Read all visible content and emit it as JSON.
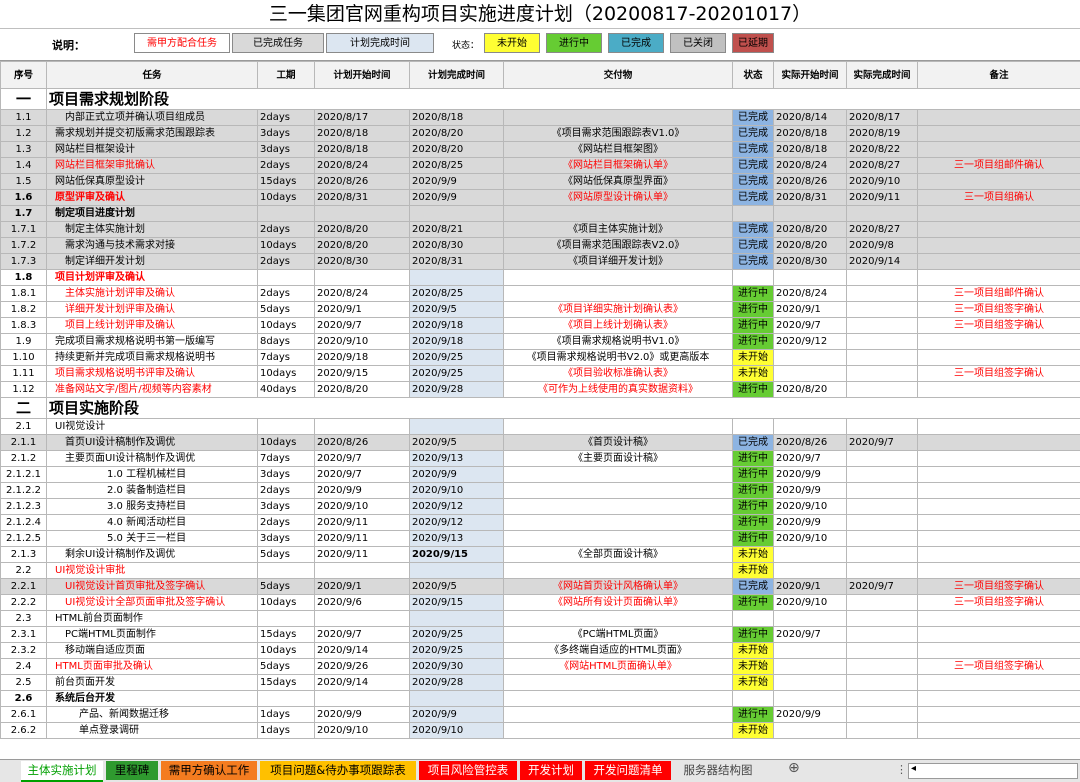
{
  "title": "三一集团官网重构项目实施进度计划（20200817-20201017）",
  "legend": {
    "label": "说明：",
    "items": [
      {
        "text": "需甲方配合任务",
        "bg": "#ffffff",
        "color": "#ff0000"
      },
      {
        "text": "已完成任务",
        "bg": "#d9d9d9",
        "color": "#000000"
      },
      {
        "text": "计划完成时间",
        "bg": "#dce6f1",
        "color": "#000000"
      }
    ],
    "status_label": "状态：",
    "statuses": [
      {
        "text": "未开始",
        "bg": "#ffff33"
      },
      {
        "text": "进行中",
        "bg": "#66cc33"
      },
      {
        "text": "已完成",
        "bg": "#4bacc6"
      },
      {
        "text": "已关闭",
        "bg": "#c0c0c0"
      },
      {
        "text": "已延期",
        "bg": "#c0504d"
      }
    ]
  },
  "columns": [
    "序号",
    "任务",
    "工期",
    "计划开始时间",
    "计划完成时间",
    "交付物",
    "状态",
    "实际开始时间",
    "实际完成时间",
    "备注"
  ],
  "rows": [
    {
      "type": "phase",
      "num": "一",
      "task": "项目需求规划阶段"
    },
    {
      "num": "1.1",
      "task": "内部正式立项并确认项目组成员",
      "dur": "2days",
      "ps": "2020/8/17",
      "pe": "2020/8/18",
      "deliv": "",
      "status": "已完成",
      "as": "2020/8/14",
      "ae": "2020/8/17",
      "note": "",
      "gray": true,
      "indent": 1
    },
    {
      "num": "1.2",
      "task": "需求规划并提交初版需求范围跟踪表",
      "dur": "3days",
      "ps": "2020/8/18",
      "pe": "2020/8/20",
      "deliv": "《项目需求范围跟踪表V1.0》",
      "status": "已完成",
      "as": "2020/8/18",
      "ae": "2020/8/19",
      "note": "",
      "gray": true,
      "indent": 0
    },
    {
      "num": "1.3",
      "task": "网站栏目框架设计",
      "dur": "3days",
      "ps": "2020/8/18",
      "pe": "2020/8/20",
      "deliv": "《网站栏目框架图》",
      "status": "已完成",
      "as": "2020/8/18",
      "ae": "2020/8/22",
      "note": "",
      "gray": true,
      "indent": 0
    },
    {
      "num": "1.4",
      "task": "网站栏目框架审批确认",
      "dur": "2days",
      "ps": "2020/8/24",
      "pe": "2020/8/25",
      "deliv": "《网站栏目框架确认单》",
      "status": "已完成",
      "as": "2020/8/24",
      "ae": "2020/8/27",
      "note": "三一项目组邮件确认",
      "gray": true,
      "red": true,
      "indent": 0
    },
    {
      "num": "1.5",
      "task": "网站低保真原型设计",
      "dur": "15days",
      "ps": "2020/8/26",
      "pe": "2020/9/9",
      "deliv": "《网站低保真原型界面》",
      "status": "已完成",
      "as": "2020/8/26",
      "ae": "2020/9/10",
      "note": "",
      "gray": true,
      "indent": 0
    },
    {
      "num": "1.6",
      "task": "原型评审及确认",
      "dur": "10days",
      "ps": "2020/8/31",
      "pe": "2020/9/9",
      "deliv": "《网站原型设计确认单》",
      "status": "已完成",
      "as": "2020/8/31",
      "ae": "2020/9/11",
      "note": "三一项目组确认",
      "gray": true,
      "red": true,
      "bold": true,
      "indent": 0
    },
    {
      "num": "1.7",
      "task": "制定项目进度计划",
      "dur": "",
      "ps": "",
      "pe": "",
      "deliv": "",
      "status": "",
      "as": "",
      "ae": "",
      "note": "",
      "gray": true,
      "bold": true,
      "indent": 0
    },
    {
      "num": "1.7.1",
      "task": "制定主体实施计划",
      "dur": "2days",
      "ps": "2020/8/20",
      "pe": "2020/8/21",
      "deliv": "《项目主体实施计划》",
      "status": "已完成",
      "as": "2020/8/20",
      "ae": "2020/8/27",
      "note": "",
      "gray": true,
      "indent": 1
    },
    {
      "num": "1.7.2",
      "task": "需求沟通与技术需求对接",
      "dur": "10days",
      "ps": "2020/8/20",
      "pe": "2020/8/30",
      "deliv": "《项目需求范围跟踪表V2.0》",
      "status": "已完成",
      "as": "2020/8/20",
      "ae": "2020/9/8",
      "note": "",
      "gray": true,
      "indent": 1
    },
    {
      "num": "1.7.3",
      "task": "制定详细开发计划",
      "dur": "2days",
      "ps": "2020/8/30",
      "pe": "2020/8/31",
      "deliv": "《项目详细开发计划》",
      "status": "已完成",
      "as": "2020/8/30",
      "ae": "2020/9/14",
      "note": "",
      "gray": true,
      "indent": 1
    },
    {
      "num": "1.8",
      "task": "项目计划评审及确认",
      "dur": "",
      "ps": "",
      "pe": "",
      "deliv": "",
      "status": "",
      "as": "",
      "ae": "",
      "note": "",
      "red": true,
      "bold": true,
      "indent": 0
    },
    {
      "num": "1.8.1",
      "task": "主体实施计划评审及确认",
      "dur": "2days",
      "ps": "2020/8/24",
      "pe": "2020/8/25",
      "deliv": "",
      "status": "进行中",
      "as": "2020/8/24",
      "ae": "",
      "note": "三一项目组邮件确认",
      "red": true,
      "indent": 1
    },
    {
      "num": "1.8.2",
      "task": "详细开发计划评审及确认",
      "dur": "5days",
      "ps": "2020/9/1",
      "pe": "2020/9/5",
      "deliv": "《项目详细实施计划确认表》",
      "status": "进行中",
      "as": "2020/9/1",
      "ae": "",
      "note": "三一项目组签字确认",
      "red": true,
      "indent": 1
    },
    {
      "num": "1.8.3",
      "task": "项目上线计划评审及确认",
      "dur": "10days",
      "ps": "2020/9/7",
      "pe": "2020/9/18",
      "deliv": "《项目上线计划确认表》",
      "status": "进行中",
      "as": "2020/9/7",
      "ae": "",
      "note": "三一项目组签字确认",
      "red": true,
      "indent": 1
    },
    {
      "num": "1.9",
      "task": "完成项目需求规格说明书第一版编写",
      "dur": "8days",
      "ps": "2020/9/10",
      "pe": "2020/9/18",
      "deliv": "《项目需求规格说明书V1.0》",
      "status": "进行中",
      "as": "2020/9/12",
      "ae": "",
      "note": "",
      "indent": 0
    },
    {
      "num": "1.10",
      "task": "持续更新并完成项目需求规格说明书",
      "dur": "7days",
      "ps": "2020/9/18",
      "pe": "2020/9/25",
      "deliv": "《项目需求规格说明书V2.0》或更高版本",
      "status": "未开始",
      "as": "",
      "ae": "",
      "note": "",
      "indent": 0
    },
    {
      "num": "1.11",
      "task": "项目需求规格说明书评审及确认",
      "dur": "10days",
      "ps": "2020/9/15",
      "pe": "2020/9/25",
      "deliv": "《项目验收标准确认表》",
      "status": "未开始",
      "as": "",
      "ae": "",
      "note": "三一项目组签字确认",
      "red": true,
      "indent": 0
    },
    {
      "num": "1.12",
      "task": "准备网站文字/图片/视频等内容素材",
      "dur": "40days",
      "ps": "2020/8/20",
      "pe": "2020/9/28",
      "deliv": "《可作为上线使用的真实数据资料》",
      "status": "进行中",
      "as": "2020/8/20",
      "ae": "",
      "note": "",
      "red": true,
      "indent": 0
    },
    {
      "type": "phase",
      "num": "二",
      "task": "项目实施阶段"
    },
    {
      "num": "2.1",
      "task": "UI视觉设计",
      "dur": "",
      "ps": "",
      "pe": "",
      "deliv": "",
      "status": "",
      "as": "",
      "ae": "",
      "note": "",
      "indent": 0
    },
    {
      "num": "2.1.1",
      "task": "首页UI设计稿制作及调优",
      "dur": "10days",
      "ps": "2020/8/26",
      "pe": "2020/9/5",
      "deliv": "《首页设计稿》",
      "status": "已完成",
      "as": "2020/8/26",
      "ae": "2020/9/7",
      "note": "",
      "gray": true,
      "indent": 1
    },
    {
      "num": "2.1.2",
      "task": "主要页面UI设计稿制作及调优",
      "dur": "7days",
      "ps": "2020/9/7",
      "pe": "2020/9/13",
      "deliv": "《主要页面设计稿》",
      "status": "进行中",
      "as": "2020/9/7",
      "ae": "",
      "note": "",
      "indent": 1
    },
    {
      "num": "2.1.2.1",
      "task": "1.0 工程机械栏目",
      "dur": "3days",
      "ps": "2020/9/7",
      "pe": "2020/9/9",
      "deliv": "",
      "status": "进行中",
      "as": "2020/9/9",
      "ae": "",
      "note": "",
      "indent": 4
    },
    {
      "num": "2.1.2.2",
      "task": "2.0 装备制造栏目",
      "dur": "2days",
      "ps": "2020/9/9",
      "pe": "2020/9/10",
      "deliv": "",
      "status": "进行中",
      "as": "2020/9/9",
      "ae": "",
      "note": "",
      "indent": 4
    },
    {
      "num": "2.1.2.3",
      "task": "3.0 服务支持栏目",
      "dur": "3days",
      "ps": "2020/9/10",
      "pe": "2020/9/12",
      "deliv": "",
      "status": "进行中",
      "as": "2020/9/10",
      "ae": "",
      "note": "",
      "indent": 4
    },
    {
      "num": "2.1.2.4",
      "task": "4.0 新闻活动栏目",
      "dur": "2days",
      "ps": "2020/9/11",
      "pe": "2020/9/12",
      "deliv": "",
      "status": "进行中",
      "as": "2020/9/9",
      "ae": "",
      "note": "",
      "indent": 4
    },
    {
      "num": "2.1.2.5",
      "task": "5.0 关于三一栏目",
      "dur": "3days",
      "ps": "2020/9/11",
      "pe": "2020/9/13",
      "deliv": "",
      "status": "进行中",
      "as": "2020/9/10",
      "ae": "",
      "note": "",
      "indent": 4
    },
    {
      "num": "2.1.3",
      "task": "剩余UI设计稿制作及调优",
      "dur": "5days",
      "ps": "2020/9/11",
      "pe": "2020/9/15",
      "deliv": "《全部页面设计稿》",
      "status": "未开始",
      "as": "",
      "ae": "",
      "note": "",
      "indent": 1,
      "pe_bold": true
    },
    {
      "num": "2.2",
      "task": "UI视觉设计审批",
      "dur": "",
      "ps": "",
      "pe": "",
      "deliv": "",
      "status": "未开始",
      "as": "",
      "ae": "",
      "note": "",
      "red": true,
      "indent": 0
    },
    {
      "num": "2.2.1",
      "task": "UI视觉设计首页审批及签字确认",
      "dur": "5days",
      "ps": "2020/9/1",
      "pe": "2020/9/5",
      "deliv": "《网站首页设计风格确认单》",
      "status": "已完成",
      "as": "2020/9/1",
      "ae": "2020/9/7",
      "note": "三一项目组签字确认",
      "gray": true,
      "red": true,
      "indent": 1
    },
    {
      "num": "2.2.2",
      "task": "UI视觉设计全部页面审批及签字确认",
      "dur": "10days",
      "ps": "2020/9/6",
      "pe": "2020/9/15",
      "deliv": "《网站所有设计页面确认单》",
      "status": "进行中",
      "as": "2020/9/10",
      "ae": "",
      "note": "三一项目组签字确认",
      "red": true,
      "indent": 1
    },
    {
      "num": "2.3",
      "task": "HTML前台页面制作",
      "dur": "",
      "ps": "",
      "pe": "",
      "deliv": "",
      "status": "",
      "as": "",
      "ae": "",
      "note": "",
      "indent": 0
    },
    {
      "num": "2.3.1",
      "task": "PC端HTML页面制作",
      "dur": "15days",
      "ps": "2020/9/7",
      "pe": "2020/9/25",
      "deliv": "《PC端HTML页面》",
      "status": "进行中",
      "as": "2020/9/7",
      "ae": "",
      "note": "",
      "indent": 1
    },
    {
      "num": "2.3.2",
      "task": "移动端自适应页面",
      "dur": "10days",
      "ps": "2020/9/14",
      "pe": "2020/9/25",
      "deliv": "《多终端自适应的HTML页面》",
      "status": "未开始",
      "as": "",
      "ae": "",
      "note": "",
      "indent": 1
    },
    {
      "num": "2.4",
      "task": "HTML页面审批及确认",
      "dur": "5days",
      "ps": "2020/9/26",
      "pe": "2020/9/30",
      "deliv": "《网站HTML页面确认单》",
      "status": "未开始",
      "as": "",
      "ae": "",
      "note": "三一项目组签字确认",
      "red": true,
      "indent": 0
    },
    {
      "num": "2.5",
      "task": "前台页面开发",
      "dur": "15days",
      "ps": "2020/9/14",
      "pe": "2020/9/28",
      "deliv": "",
      "status": "未开始",
      "as": "",
      "ae": "",
      "note": "",
      "indent": 0
    },
    {
      "num": "2.6",
      "task": "系统后台开发",
      "dur": "",
      "ps": "",
      "pe": "",
      "deliv": "",
      "status": "",
      "as": "",
      "ae": "",
      "note": "",
      "bold": true,
      "indent": 0
    },
    {
      "num": "2.6.1",
      "task": "产品、新闻数据迁移",
      "dur": "1days",
      "ps": "2020/9/9",
      "pe": "2020/9/9",
      "deliv": "",
      "status": "进行中",
      "as": "2020/9/9",
      "ae": "",
      "note": "",
      "indent": 2
    },
    {
      "num": "2.6.2",
      "task": "单点登录调研",
      "dur": "1days",
      "ps": "2020/9/10",
      "pe": "2020/9/10",
      "deliv": "",
      "status": "未开始",
      "as": "",
      "ae": "",
      "note": "",
      "indent": 2
    }
  ],
  "tabs": [
    {
      "label": "主体实施计划",
      "bg": "#ffffff",
      "color": "#00a000",
      "active": true
    },
    {
      "label": "里程碑",
      "bg": "#2f9a2f",
      "color": "#000000"
    },
    {
      "label": "需甲方确认工作",
      "bg": "#f47c20",
      "color": "#000000"
    },
    {
      "label": "项目问题&待办事项跟踪表",
      "bg": "#ffc000",
      "color": "#000000"
    },
    {
      "label": "项目风险管控表",
      "bg": "#ff0000",
      "color": "#ffffff"
    },
    {
      "label": "开发计划",
      "bg": "#ff0000",
      "color": "#ffffff"
    },
    {
      "label": "开发问题清单",
      "bg": "#ff0000",
      "color": "#ffffff"
    },
    {
      "label": "服务器结构图",
      "bg": "#e6e6e6",
      "color": "#444444"
    }
  ],
  "tab_controls": {
    "add": "⊕",
    "more": "⋮",
    "scroll_left": "◂"
  }
}
